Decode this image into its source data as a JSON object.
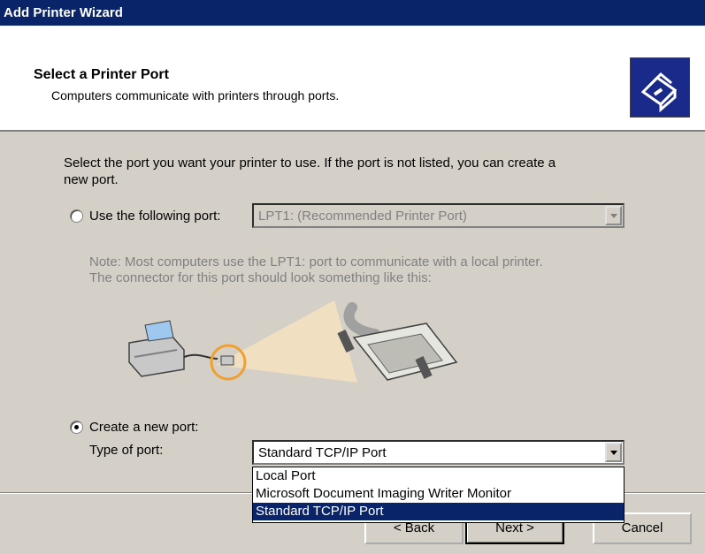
{
  "window": {
    "title": "Add Printer Wizard"
  },
  "header": {
    "title": "Select a Printer Port",
    "subtitle": "Computers communicate with printers through ports."
  },
  "intro": {
    "line1": "Select the port you want your printer to use.  If the port is not listed, you can create a",
    "line2": "new port."
  },
  "use_port": {
    "label": "Use the following port:",
    "selected": false,
    "value": "LPT1: (Recommended Printer Port)"
  },
  "note": {
    "line1": "Note: Most computers use the LPT1: port to communicate with a local printer.",
    "line2": "The connector for this port should look something like this:"
  },
  "create_port": {
    "label": "Create a new port:",
    "selected": true,
    "type_label": "Type of port:",
    "value": "Standard TCP/IP Port",
    "options": [
      "Local Port",
      "Microsoft Document Imaging Writer Monitor",
      "Standard TCP/IP Port"
    ],
    "highlighted_index": 2
  },
  "buttons": {
    "back": "< Back",
    "next": "Next >",
    "cancel": "Cancel"
  },
  "colors": {
    "titlebar": "#0a246a",
    "selection": "#0a246a",
    "dialog": "#d4d0c8",
    "callout": "#f0a030"
  }
}
